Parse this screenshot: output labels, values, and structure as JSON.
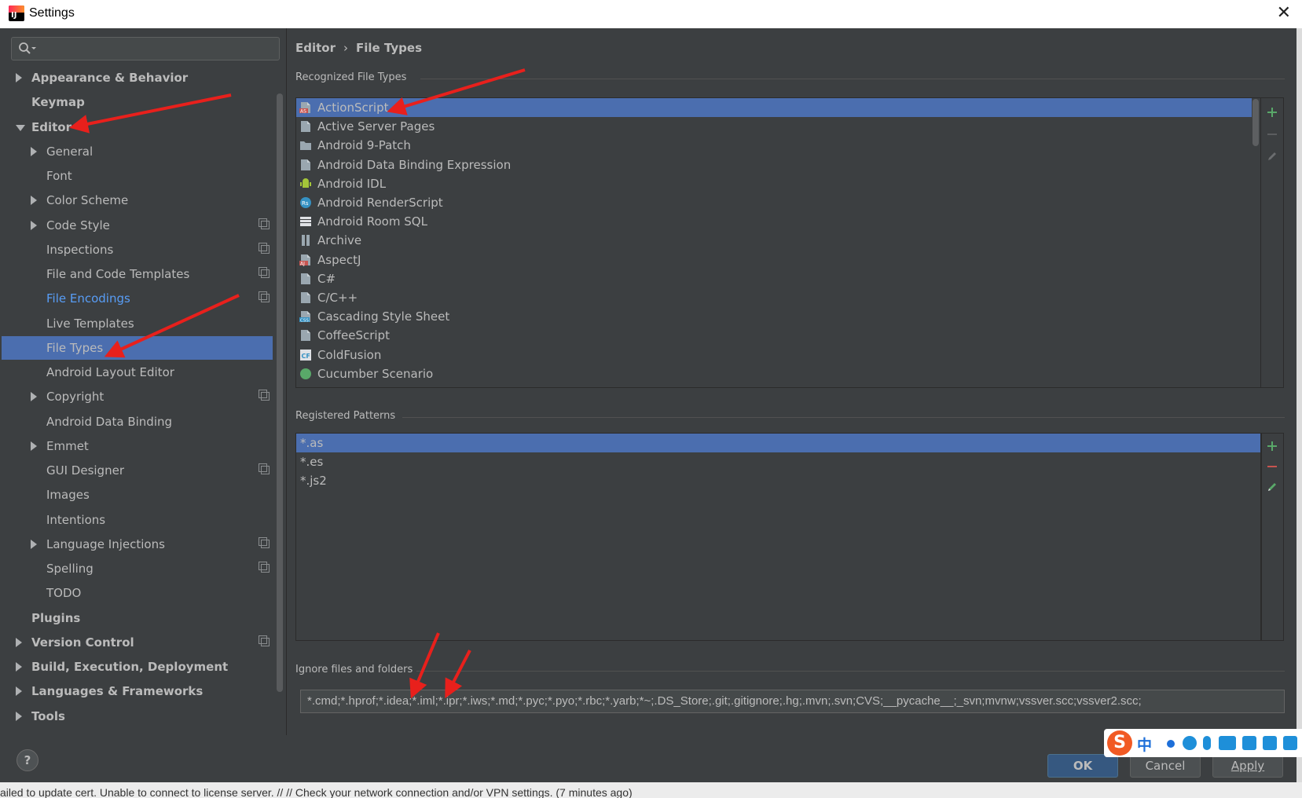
{
  "window": {
    "title": "Settings",
    "close": "✕"
  },
  "search": {
    "placeholder": ""
  },
  "tree": [
    {
      "label": "Appearance & Behavior",
      "level": 0,
      "arrow": "right",
      "kind": "top"
    },
    {
      "label": "Keymap",
      "level": 0,
      "arrow": "none",
      "kind": "top"
    },
    {
      "label": "Editor",
      "level": 0,
      "arrow": "down",
      "kind": "top"
    },
    {
      "label": "General",
      "level": 1,
      "arrow": "right"
    },
    {
      "label": "Font",
      "level": 1,
      "arrow": "none"
    },
    {
      "label": "Color Scheme",
      "level": 1,
      "arrow": "right"
    },
    {
      "label": "Code Style",
      "level": 1,
      "arrow": "right",
      "copy": true
    },
    {
      "label": "Inspections",
      "level": 1,
      "arrow": "none",
      "copy": true
    },
    {
      "label": "File and Code Templates",
      "level": 1,
      "arrow": "none",
      "copy": true
    },
    {
      "label": "File Encodings",
      "level": 1,
      "arrow": "none",
      "copy": true,
      "kind": "modified"
    },
    {
      "label": "Live Templates",
      "level": 1,
      "arrow": "none"
    },
    {
      "label": "File Types",
      "level": 1,
      "arrow": "none",
      "selected": true
    },
    {
      "label": "Android Layout Editor",
      "level": 1,
      "arrow": "none"
    },
    {
      "label": "Copyright",
      "level": 1,
      "arrow": "right",
      "copy": true
    },
    {
      "label": "Android Data Binding",
      "level": 1,
      "arrow": "none"
    },
    {
      "label": "Emmet",
      "level": 1,
      "arrow": "right"
    },
    {
      "label": "GUI Designer",
      "level": 1,
      "arrow": "none",
      "copy": true
    },
    {
      "label": "Images",
      "level": 1,
      "arrow": "none"
    },
    {
      "label": "Intentions",
      "level": 1,
      "arrow": "none"
    },
    {
      "label": "Language Injections",
      "level": 1,
      "arrow": "right",
      "copy": true
    },
    {
      "label": "Spelling",
      "level": 1,
      "arrow": "none",
      "copy": true
    },
    {
      "label": "TODO",
      "level": 1,
      "arrow": "none"
    },
    {
      "label": "Plugins",
      "level": 0,
      "arrow": "none",
      "kind": "top"
    },
    {
      "label": "Version Control",
      "level": 0,
      "arrow": "right",
      "kind": "top",
      "copy": true
    },
    {
      "label": "Build, Execution, Deployment",
      "level": 0,
      "arrow": "right",
      "kind": "top"
    },
    {
      "label": "Languages & Frameworks",
      "level": 0,
      "arrow": "right",
      "kind": "top"
    },
    {
      "label": "Tools",
      "level": 0,
      "arrow": "right",
      "kind": "top"
    }
  ],
  "breadcrumb": {
    "parent": "Editor",
    "separator": "›",
    "current": "File Types"
  },
  "recognized": {
    "label": "Recognized File Types",
    "items": [
      {
        "name": "ActionScript",
        "icon": "as",
        "selected": true
      },
      {
        "name": "Active Server Pages",
        "icon": "doc"
      },
      {
        "name": "Android 9-Patch",
        "icon": "folder"
      },
      {
        "name": "Android Data Binding Expression",
        "icon": "doc"
      },
      {
        "name": "Android IDL",
        "icon": "android"
      },
      {
        "name": "Android RenderScript",
        "icon": "rs"
      },
      {
        "name": "Android Room SQL",
        "icon": "table"
      },
      {
        "name": "Archive",
        "icon": "archive"
      },
      {
        "name": "AspectJ",
        "icon": "aj"
      },
      {
        "name": "C#",
        "icon": "doc"
      },
      {
        "name": "C/C++",
        "icon": "doc"
      },
      {
        "name": "Cascading Style Sheet",
        "icon": "css"
      },
      {
        "name": "CoffeeScript",
        "icon": "doc"
      },
      {
        "name": "ColdFusion",
        "icon": "cf"
      },
      {
        "name": "Cucumber Scenario",
        "icon": "cucumber"
      }
    ]
  },
  "patterns": {
    "label": "Registered Patterns",
    "items": [
      {
        "name": "*.as",
        "selected": true
      },
      {
        "name": "*.es"
      },
      {
        "name": "*.js2"
      }
    ]
  },
  "ignore": {
    "label": "Ignore files and folders",
    "value": "*.cmd;*.hprof;*.idea;*.iml;*.ipr;*.iws;*.md;*.pyc;*.pyo;*.rbc;*.yarb;*~;.DS_Store;.git;.gitignore;.hg;.mvn;.svn;CVS;__pycache__;_svn;mvnw;vssver.scc;vssver2.scc;"
  },
  "buttons": {
    "help": "?",
    "ok": "OK",
    "cancel": "Cancel",
    "apply": "Apply"
  },
  "status": "ailed to update cert. Unable to connect to license server. // // Check your network connection and/or VPN settings. (7 minutes ago)",
  "ime": {
    "logo": "S",
    "mode": "中"
  },
  "colors": {
    "selection": "#4b6eaf",
    "add": "#59a869",
    "remove": "#c75450",
    "modified": "#589df6",
    "annotation_arrow": "#e8201c"
  }
}
